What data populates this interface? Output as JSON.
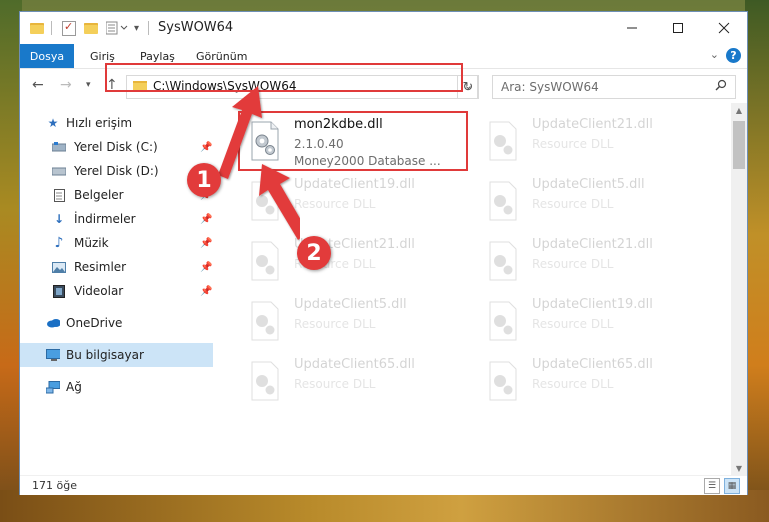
{
  "window": {
    "title": "SysWOW64"
  },
  "ribbon": {
    "tabs": [
      "Dosya",
      "Giriş",
      "Paylaş",
      "Görünüm"
    ],
    "help": "?"
  },
  "address": {
    "path": "C:\\Windows\\SysWOW64",
    "search_placeholder": "Ara: SysWOW64"
  },
  "sidebar": {
    "items": [
      {
        "label": "Hızlı erişim",
        "icon": "star-icon",
        "pinned": false
      },
      {
        "label": "Yerel Disk (C:)",
        "icon": "drive-icon",
        "pinned": true
      },
      {
        "label": "Yerel Disk (D:)",
        "icon": "drive-icon",
        "pinned": true
      },
      {
        "label": "Belgeler",
        "icon": "documents-icon",
        "pinned": true
      },
      {
        "label": "İndirmeler",
        "icon": "download-icon",
        "pinned": true
      },
      {
        "label": "Müzik",
        "icon": "music-icon",
        "pinned": true
      },
      {
        "label": "Resimler",
        "icon": "pictures-icon",
        "pinned": true
      },
      {
        "label": "Videolar",
        "icon": "videos-icon",
        "pinned": true
      },
      {
        "label": "OneDrive",
        "icon": "cloud-icon",
        "pinned": false
      },
      {
        "label": "Bu bilgisayar",
        "icon": "computer-icon",
        "pinned": false
      },
      {
        "label": "Ağ",
        "icon": "network-icon",
        "pinned": false
      }
    ]
  },
  "files": [
    {
      "name": "mon2kdbe.dll",
      "line2": "2.1.0.40",
      "line3": "Money2000 Database ..."
    },
    {
      "name": "UpdateClient21.dll",
      "line2": "Resource DLL"
    },
    {
      "name": "UpdateClient19.dll",
      "line2": "Resource DLL"
    },
    {
      "name": "UpdateClient5.dll",
      "line2": "Resource DLL"
    },
    {
      "name": "UpdateClient21.dll",
      "line2": "Resource DLL"
    },
    {
      "name": "UpdateClient21.dll",
      "line2": "Resource DLL"
    },
    {
      "name": "UpdateClient5.dll",
      "line2": "Resource DLL"
    },
    {
      "name": "UpdateClient19.dll",
      "line2": "Resource DLL"
    },
    {
      "name": "UpdateClient65.dll",
      "line2": "Resource DLL"
    },
    {
      "name": "UpdateClient65.dll",
      "line2": "Resource DLL"
    }
  ],
  "status": {
    "count": "171 öğe"
  },
  "annotations": {
    "step1": "1",
    "step2": "2",
    "color": "#e23b3b"
  }
}
